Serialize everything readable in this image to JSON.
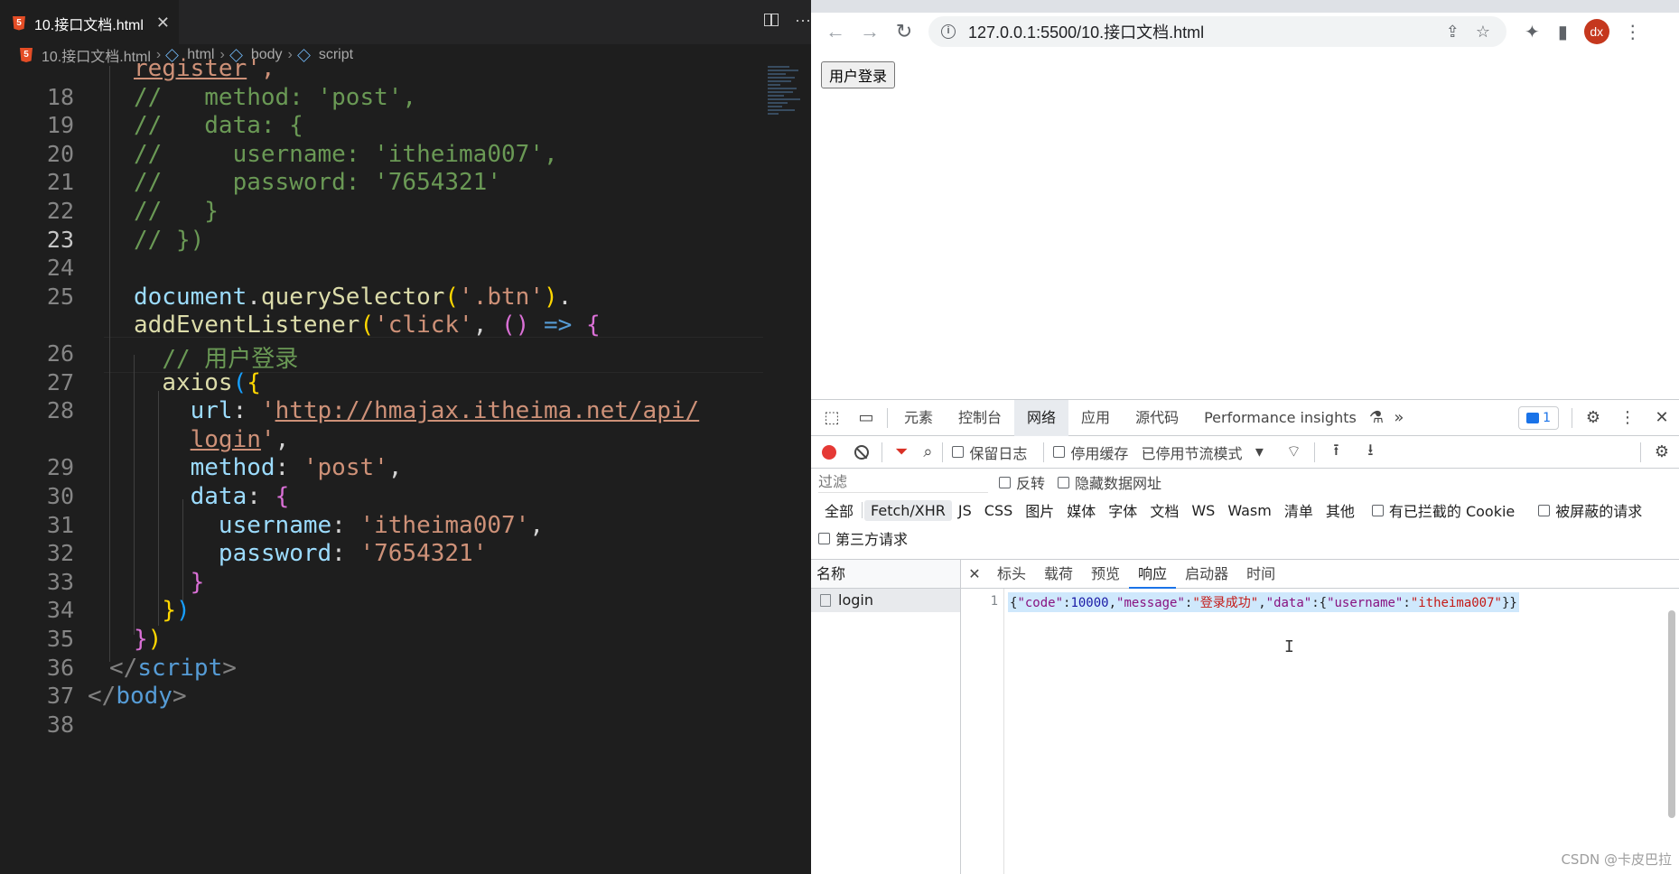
{
  "vscode": {
    "tab": {
      "filename": "10.接口文档.html",
      "html_badge": "5"
    },
    "breadcrumb": [
      "10.接口文档.html",
      "html",
      "body",
      "script"
    ],
    "lines": [
      {
        "num": "",
        "tokens": [
          [
            "url",
            "register"
          ],
          [
            "str",
            "',"
          ]
        ]
      },
      {
        "num": "18",
        "tokens": [
          [
            "cm",
            "//   method: 'post',"
          ]
        ]
      },
      {
        "num": "19",
        "tokens": [
          [
            "cm",
            "//   data: {"
          ]
        ]
      },
      {
        "num": "20",
        "tokens": [
          [
            "cm",
            "//     username: 'itheima007',"
          ]
        ]
      },
      {
        "num": "21",
        "tokens": [
          [
            "cm",
            "//     password: '7654321'"
          ]
        ]
      },
      {
        "num": "22",
        "tokens": [
          [
            "cm",
            "//   }"
          ]
        ]
      },
      {
        "num": "23",
        "tokens": [
          [
            "cm",
            "// })"
          ]
        ]
      },
      {
        "num": "24",
        "tokens": []
      },
      {
        "num": "25",
        "tokens": [
          [
            "prop",
            "document"
          ],
          [
            "txt",
            "."
          ],
          [
            "fn",
            "querySelector"
          ],
          [
            "br1",
            "("
          ],
          [
            "str",
            "'.btn'"
          ],
          [
            "br1",
            ")"
          ],
          [
            "txt",
            "."
          ]
        ]
      },
      {
        "num": "",
        "tokens": [
          [
            "fn",
            "addEventListener"
          ],
          [
            "br1",
            "("
          ],
          [
            "str",
            "'click'"
          ],
          [
            "txt",
            ", "
          ],
          [
            "br2",
            "()"
          ],
          [
            "txt",
            " "
          ],
          [
            "kw",
            "=>"
          ],
          [
            "txt",
            " "
          ],
          [
            "br2",
            "{"
          ]
        ]
      },
      {
        "num": "26",
        "tokens": [
          [
            "txt",
            "  "
          ],
          [
            "cm",
            "// 用户登录"
          ]
        ]
      },
      {
        "num": "27",
        "tokens": [
          [
            "txt",
            "  "
          ],
          [
            "fn",
            "axios"
          ],
          [
            "br3",
            "("
          ],
          [
            "br1",
            "{"
          ]
        ]
      },
      {
        "num": "28",
        "tokens": [
          [
            "txt",
            "    "
          ],
          [
            "prop",
            "url"
          ],
          [
            "txt",
            ": "
          ],
          [
            "str",
            "'"
          ],
          [
            "url",
            "http://hmajax.itheima.net/api/"
          ]
        ]
      },
      {
        "num": "",
        "tokens": [
          [
            "txt",
            "    "
          ],
          [
            "url",
            "login"
          ],
          [
            "str",
            "'"
          ],
          [
            "txt",
            ","
          ]
        ]
      },
      {
        "num": "29",
        "tokens": [
          [
            "txt",
            "    "
          ],
          [
            "prop",
            "method"
          ],
          [
            "txt",
            ": "
          ],
          [
            "str",
            "'post'"
          ],
          [
            "txt",
            ","
          ]
        ]
      },
      {
        "num": "30",
        "tokens": [
          [
            "txt",
            "    "
          ],
          [
            "prop",
            "data"
          ],
          [
            "txt",
            ": "
          ],
          [
            "br2",
            "{"
          ]
        ]
      },
      {
        "num": "31",
        "tokens": [
          [
            "txt",
            "      "
          ],
          [
            "prop",
            "username"
          ],
          [
            "txt",
            ": "
          ],
          [
            "str",
            "'itheima007'"
          ],
          [
            "txt",
            ","
          ]
        ]
      },
      {
        "num": "32",
        "tokens": [
          [
            "txt",
            "      "
          ],
          [
            "prop",
            "password"
          ],
          [
            "txt",
            ": "
          ],
          [
            "str",
            "'7654321'"
          ]
        ]
      },
      {
        "num": "33",
        "tokens": [
          [
            "txt",
            "    "
          ],
          [
            "br2",
            "}"
          ]
        ]
      },
      {
        "num": "34",
        "tokens": [
          [
            "txt",
            "  "
          ],
          [
            "br1",
            "}"
          ],
          [
            "br3",
            ")"
          ]
        ]
      },
      {
        "num": "35",
        "tokens": [
          [
            "br2",
            "}"
          ],
          [
            "br1",
            ")"
          ]
        ]
      },
      {
        "num": "36",
        "tokens": [
          [
            "tagb",
            "</"
          ],
          [
            "tag",
            "script"
          ],
          [
            "tagb",
            ">"
          ]
        ]
      },
      {
        "num": "37",
        "tokens": [
          [
            "tagb",
            "</"
          ],
          [
            "tag",
            "body"
          ],
          [
            "tagb",
            ">"
          ]
        ]
      },
      {
        "num": "38",
        "tokens": []
      }
    ],
    "active_line": "23"
  },
  "browser": {
    "url": "127.0.0.1:5500/10.接口文档.html",
    "profile_initials": "dx",
    "page": {
      "login_button": "用户登录"
    },
    "devtools": {
      "tabs": [
        "元素",
        "控制台",
        "网络",
        "应用",
        "源代码",
        "Performance insights"
      ],
      "selected_tab": "网络",
      "issues_count": "1",
      "net_toolbar": {
        "preserve_log": "保留日志",
        "disable_cache": "停用缓存",
        "throttling": "已停用节流模式"
      },
      "filter": {
        "placeholder": "过滤",
        "invert": "反转",
        "hide_data_urls": "隐藏数据网址"
      },
      "types": [
        "全部",
        "Fetch/XHR",
        "JS",
        "CSS",
        "图片",
        "媒体",
        "字体",
        "文档",
        "WS",
        "Wasm",
        "清单",
        "其他"
      ],
      "selected_type": "Fetch/XHR",
      "blocked_cookies": "有已拦截的 Cookie",
      "blocked_requests": "被屏蔽的请求",
      "third_party": "第三方请求",
      "request_list": {
        "header": "名称",
        "items": [
          "login"
        ]
      },
      "detail_tabs": [
        "标头",
        "载荷",
        "预览",
        "响应",
        "启动器",
        "时间"
      ],
      "selected_detail_tab": "响应",
      "response": {
        "line_number": "1",
        "text": "{\"code\":10000,\"message\":\"登录成功\",\"data\":{\"username\":\"itheima007\"}}"
      }
    }
  },
  "watermark": "CSDN @卡皮巴拉"
}
